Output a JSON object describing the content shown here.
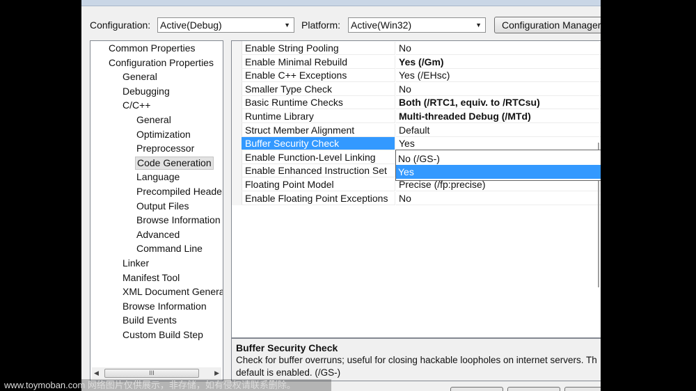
{
  "header": {
    "configuration_label": "Configuration:",
    "configuration_value": "Active(Debug)",
    "platform_label": "Platform:",
    "platform_value": "Active(Win32)",
    "config_manager_button": "Configuration Manager..."
  },
  "tree": {
    "items": [
      {
        "label": "Common Properties",
        "level": 0
      },
      {
        "label": "Configuration Properties",
        "level": 0
      },
      {
        "label": "General",
        "level": 1
      },
      {
        "label": "Debugging",
        "level": 1
      },
      {
        "label": "C/C++",
        "level": 1
      },
      {
        "label": "General",
        "level": 2
      },
      {
        "label": "Optimization",
        "level": 2
      },
      {
        "label": "Preprocessor",
        "level": 2
      },
      {
        "label": "Code Generation",
        "level": 2,
        "selected": true
      },
      {
        "label": "Language",
        "level": 2
      },
      {
        "label": "Precompiled Headers",
        "level": 2
      },
      {
        "label": "Output Files",
        "level": 2
      },
      {
        "label": "Browse Information",
        "level": 2
      },
      {
        "label": "Advanced",
        "level": 2
      },
      {
        "label": "Command Line",
        "level": 2
      },
      {
        "label": "Linker",
        "level": 1
      },
      {
        "label": "Manifest Tool",
        "level": 1
      },
      {
        "label": "XML Document Generator",
        "level": 1
      },
      {
        "label": "Browse Information",
        "level": 1
      },
      {
        "label": "Build Events",
        "level": 1
      },
      {
        "label": "Custom Build Step",
        "level": 1
      }
    ],
    "scroll_thumb_glyph": "III"
  },
  "grid": {
    "rows": [
      {
        "name": "Enable String Pooling",
        "value": "No",
        "bold": false
      },
      {
        "name": "Enable Minimal Rebuild",
        "value": "Yes (/Gm)",
        "bold": true
      },
      {
        "name": "Enable C++ Exceptions",
        "value": "Yes (/EHsc)",
        "bold": false
      },
      {
        "name": "Smaller Type Check",
        "value": "No",
        "bold": false
      },
      {
        "name": "Basic Runtime Checks",
        "value": "Both (/RTC1, equiv. to /RTCsu)",
        "bold": true
      },
      {
        "name": "Runtime Library",
        "value": "Multi-threaded Debug (/MTd)",
        "bold": true
      },
      {
        "name": "Struct Member Alignment",
        "value": "Default",
        "bold": false
      },
      {
        "name": "Buffer Security Check",
        "value": "Yes",
        "bold": false,
        "selected": true
      },
      {
        "name": "Enable Function-Level Linking",
        "value": "",
        "bold": false
      },
      {
        "name": "Enable Enhanced Instruction Set",
        "value": "",
        "bold": false
      },
      {
        "name": "Floating Point Model",
        "value": "Precise (/fp:precise)",
        "bold": false
      },
      {
        "name": "Enable Floating Point Exceptions",
        "value": "No",
        "bold": false
      }
    ],
    "dropdown_options": [
      {
        "label": "No (/GS-)",
        "highlighted": false
      },
      {
        "label": "Yes",
        "highlighted": true
      }
    ]
  },
  "description": {
    "title": "Buffer Security Check",
    "line1": "Check for buffer overruns; useful for closing hackable loopholes on internet servers.  Th",
    "line2": "default is enabled.     (/GS-)"
  },
  "watermark": "www.toymoban.com 网络图片仅供展示，非存储，如有侵权请联系删除。"
}
